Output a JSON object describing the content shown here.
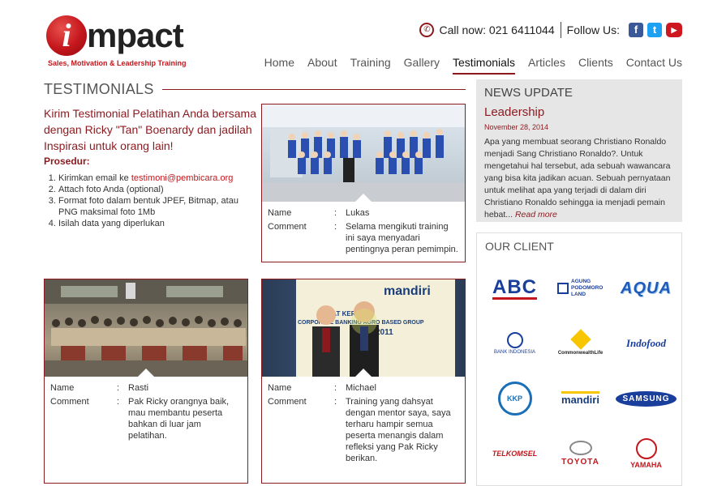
{
  "brand": {
    "logo_letter": "i",
    "logo_word": "mpact",
    "tagline": "Sales, Motivation & Leadership Training"
  },
  "topbar": {
    "call_label": "Call now: 021 6411044",
    "follow_label": "Follow Us:",
    "social": [
      {
        "name": "facebook",
        "glyph": "f"
      },
      {
        "name": "twitter",
        "glyph": "t"
      },
      {
        "name": "youtube",
        "glyph": "▶"
      }
    ]
  },
  "nav": {
    "items": [
      "Home",
      "About",
      "Training",
      "Gallery",
      "Testimonials",
      "Articles",
      "Clients",
      "Contact Us"
    ],
    "active": "Testimonials"
  },
  "section": {
    "title": "TESTIMONIALS",
    "intro": "Kirim Testimonial Pelatihan Anda bersama dengan Ricky \"Tan\" Boenardy dan jadilah Inspirasi untuk orang lain!",
    "procedure_title": "Prosedur:",
    "steps": [
      {
        "before": "Kirimkan email ke ",
        "link": "testimoni@pembicara.org",
        "after": ""
      },
      {
        "before": "Attach foto Anda (optional)",
        "link": "",
        "after": ""
      },
      {
        "before": "Format foto dalam bentuk JPEF, Bitmap, atau PNG maksimal foto 1Mb",
        "link": "",
        "after": ""
      },
      {
        "before": "Isilah data yang diperlukan",
        "link": "",
        "after": ""
      }
    ]
  },
  "field_labels": {
    "name": "Name",
    "comment": "Comment",
    "colon": ":"
  },
  "testimonials": [
    {
      "name": "Lukas",
      "comment": "Selama mengikuti training ini saya menyadari pentingnya peran pemimpin."
    },
    {
      "name": "Rasti",
      "comment": "Pak Ricky orangnya baik, mau membantu peserta bahkan di luar jam pelatihan."
    },
    {
      "name": "Michael",
      "comment": "Training yang dahsyat dengan mentor saya, saya terharu hampir semua peserta menangis dalam refleksi yang Pak Ricky berikan."
    }
  ],
  "photo_text": {
    "bank": "mandiri",
    "banner_line1": "RAPAT KERJA",
    "banner_line2": "CORPORATE BANKING AGRO BASED GROUP",
    "banner_line3": "2011"
  },
  "news": {
    "heading": "NEWS UPDATE",
    "title": "Leadership",
    "date": "November 28, 2014",
    "body": "Apa yang membuat seorang Christiano Ronaldo menjadi Sang Christiano Ronaldo?. Untuk mengetahui hal tersebut, ada sebuah wawancara yang bisa kita jadikan acuan. Sebuah pernyataan untuk melihat apa yang terjadi di dalam diri Christiano Ronaldo sehingga ia menjadi pemain hebat... ",
    "more": "Read more"
  },
  "clients": {
    "heading": "OUR CLIENT",
    "logos": [
      {
        "name": "abc",
        "text": "ABC",
        "color": "#1a3e9c"
      },
      {
        "name": "agung-podomoro",
        "text": "AGUNG PODOMORO LAND",
        "color": "#1a3e9c"
      },
      {
        "name": "aqua",
        "text": "AQUA",
        "color": "#1f5bb8"
      },
      {
        "name": "bank-indonesia",
        "text": "BANK INDONESIA",
        "color": "#1a3e9c"
      },
      {
        "name": "commonwealth",
        "text": "CommonwealthLife",
        "color": "#222222"
      },
      {
        "name": "indofood",
        "text": "Indofood",
        "color": "#1a3e9c"
      },
      {
        "name": "kementerian-kkp",
        "text": "KKP",
        "color": "#1a6fb8"
      },
      {
        "name": "mandiri",
        "text": "mandiri",
        "color": "#1a3e7a"
      },
      {
        "name": "samsung",
        "text": "SAMSUNG",
        "color": "#1a3e9c"
      },
      {
        "name": "telkomsel",
        "text": "TELKOMSEL",
        "color": "#c4161c"
      },
      {
        "name": "toyota",
        "text": "TOYOTA",
        "color": "#c4161c"
      },
      {
        "name": "yamaha",
        "text": "YAMAHA",
        "color": "#c4161c"
      }
    ]
  }
}
